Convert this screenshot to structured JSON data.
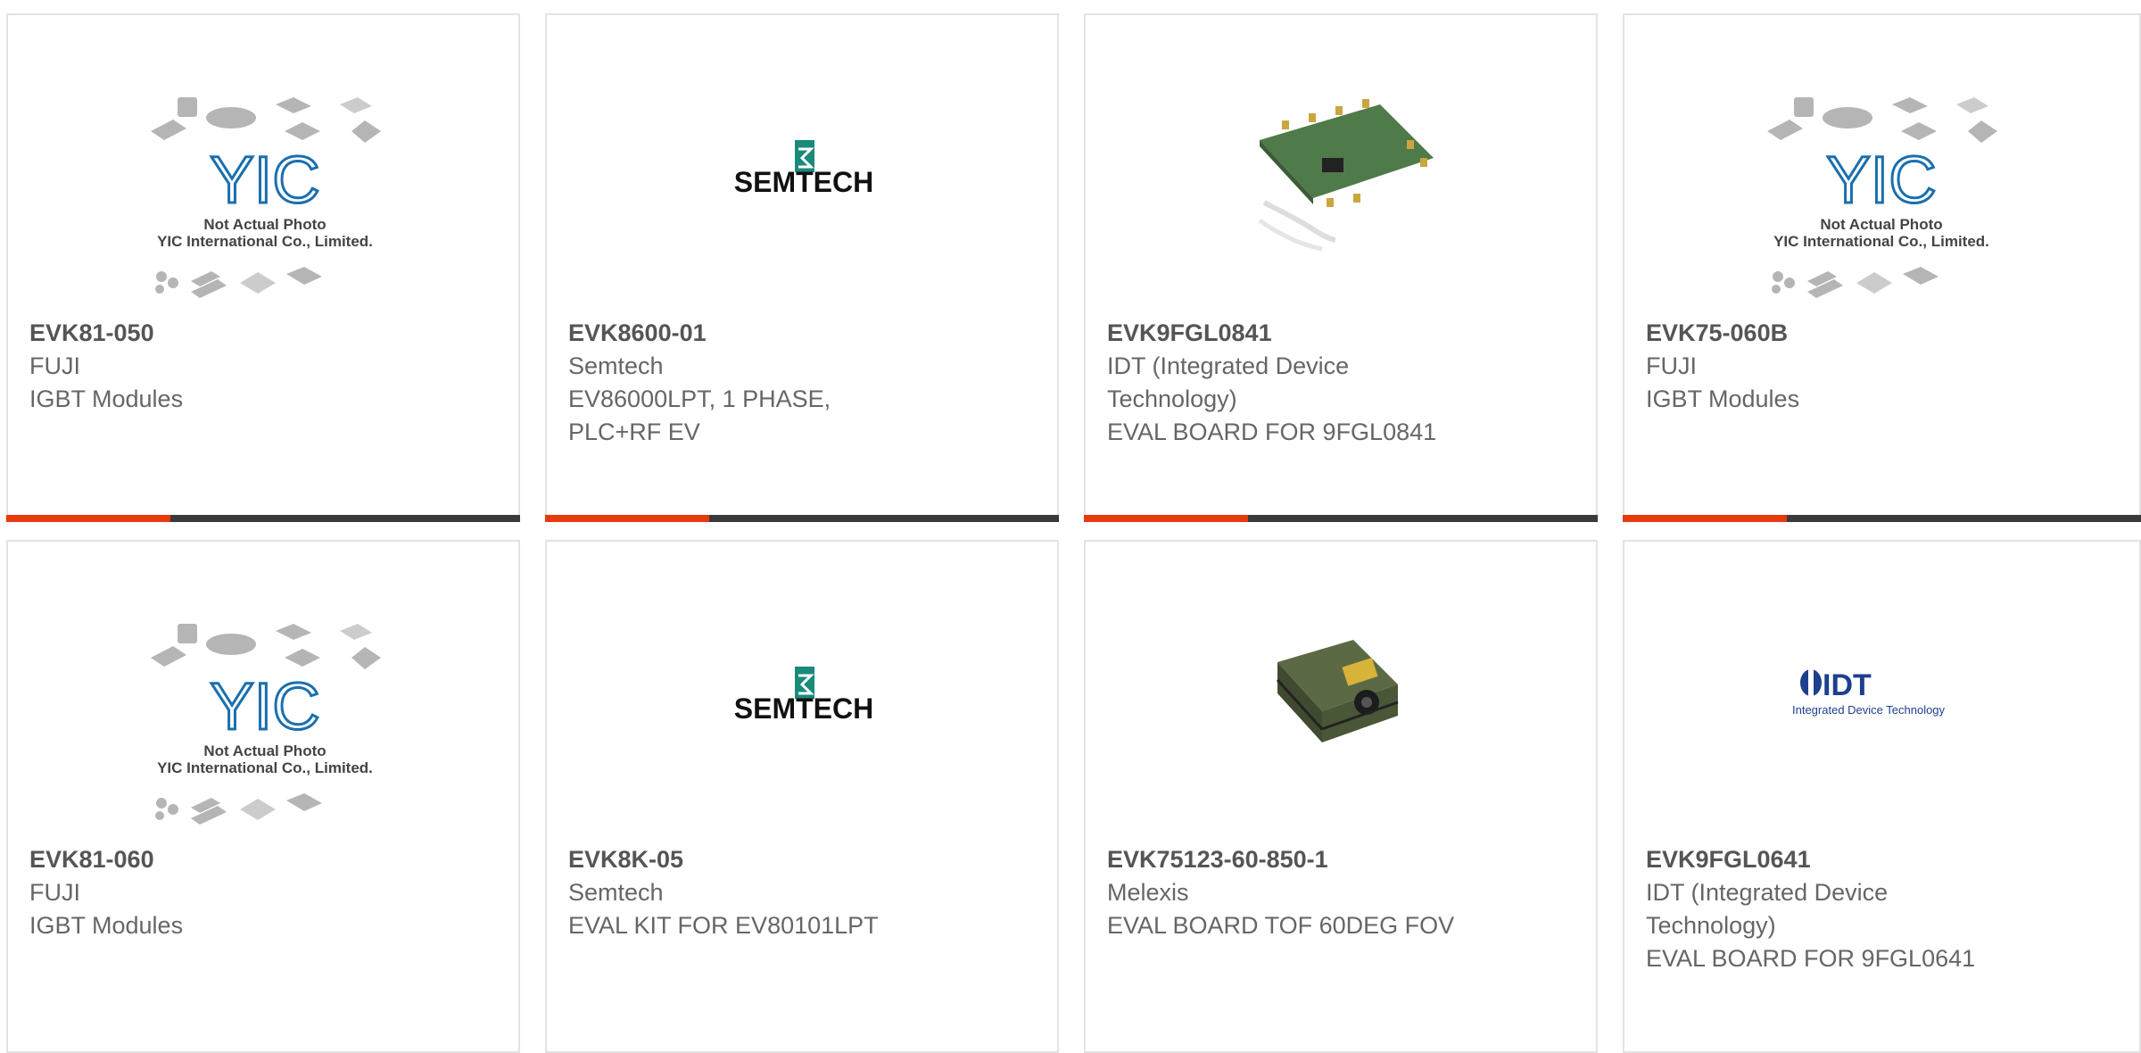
{
  "accent_color": "#e8380d",
  "dark_color": "#3a3a3a",
  "placeholder": {
    "line1": "Not Actual Photo",
    "line2": "YIC International Co., Limited.",
    "logo": "YIC"
  },
  "logos": {
    "semtech": "SEMTECH",
    "idt": "IDT",
    "idt_sub": "Integrated Device Technology"
  },
  "products": [
    {
      "part": "EVK81-050",
      "maker": "FUJI",
      "desc": [
        "IGBT Modules"
      ],
      "image": "placeholder-image"
    },
    {
      "part": "EVK8600-01",
      "maker": "Semtech",
      "desc": [
        "EV86000LPT, 1 PHASE,",
        "PLC+RF EV"
      ],
      "image": "semtech-logo"
    },
    {
      "part": "EVK9FGL0841",
      "maker": "IDT (Integrated Device",
      "desc": [
        "Technology)",
        "EVAL BOARD FOR 9FGL0841"
      ],
      "image": "eval-board-photo"
    },
    {
      "part": "EVK75-060B",
      "maker": "FUJI",
      "desc": [
        "IGBT Modules"
      ],
      "image": "placeholder-image"
    },
    {
      "part": "EVK81-060",
      "maker": "FUJI",
      "desc": [
        "IGBT Modules"
      ],
      "image": "placeholder-image"
    },
    {
      "part": "EVK8K-05",
      "maker": "Semtech",
      "desc": [
        "EVAL KIT FOR EV80101LPT"
      ],
      "image": "semtech-logo"
    },
    {
      "part": "EVK75123-60-850-1",
      "maker": "Melexis",
      "desc": [
        "EVAL BOARD TOF 60DEG FOV"
      ],
      "image": "tof-board-photo"
    },
    {
      "part": "EVK9FGL0641",
      "maker": "IDT (Integrated Device",
      "desc": [
        "Technology)",
        "EVAL BOARD FOR 9FGL0641"
      ],
      "image": "idt-logo"
    }
  ]
}
